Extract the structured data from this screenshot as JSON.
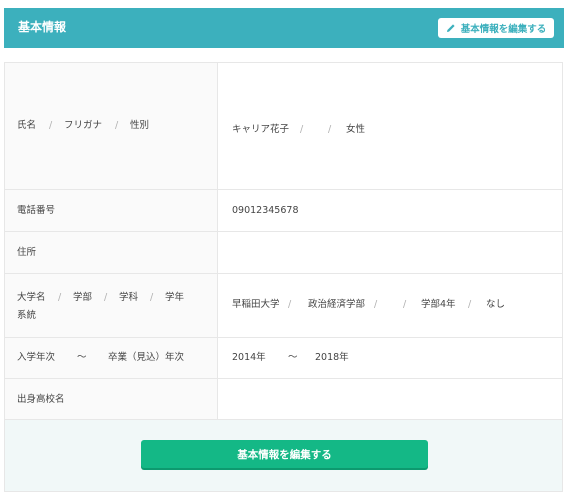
{
  "header": {
    "title": "基本情報",
    "edit_label": "基本情報を編集する"
  },
  "rows": {
    "name": {
      "label_a": "氏名",
      "label_b": "フリガナ",
      "label_c": "性別",
      "sep": "/",
      "name_value": "キャリア花子",
      "gender_value": "女性"
    },
    "phone": {
      "label": "電話番号",
      "value": "09012345678"
    },
    "address": {
      "label": "住所",
      "value": ""
    },
    "university": {
      "label_a": "大学名",
      "label_b": "学部",
      "label_c": "学科",
      "label_d": "学年",
      "label_e": "系統",
      "sep": "/",
      "univ_value": "早稲田大学",
      "faculty_value": "政治経済学部",
      "grade_value": "学部4年",
      "field_value": "なし"
    },
    "years": {
      "label_a": "入学年次",
      "label_b": "卒業（見込）年次",
      "tilde": "〜",
      "start": "2014年",
      "end": "2018年"
    },
    "highschool": {
      "label": "出身高校名",
      "value": ""
    }
  },
  "footer": {
    "edit_label": "基本情報を編集する"
  },
  "colors": {
    "teal": "#3cb0bd",
    "green": "#14b886",
    "footer_bg": "#f1f8f8"
  },
  "icons": {
    "edit": "pencil-icon"
  }
}
